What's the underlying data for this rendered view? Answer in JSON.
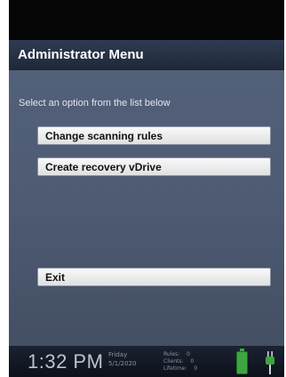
{
  "header": {
    "title": "Administrator Menu"
  },
  "main": {
    "instruction": "Select an option from the list below",
    "options": [
      {
        "label": "Change scanning rules"
      },
      {
        "label": "Create recovery vDrive"
      }
    ],
    "exit_label": "Exit"
  },
  "status_bar": {
    "time": "1:32 PM",
    "day": "Friday",
    "date": "5/1/2020",
    "counts": [
      {
        "label": "Rules:",
        "value": "0"
      },
      {
        "label": "Clients:",
        "value": "0"
      },
      {
        "label": "Lifetime:",
        "value": "0"
      }
    ],
    "battery_icon": "battery-icon",
    "power_icon": "power-plug-icon",
    "battery_color": "#3fa542"
  }
}
